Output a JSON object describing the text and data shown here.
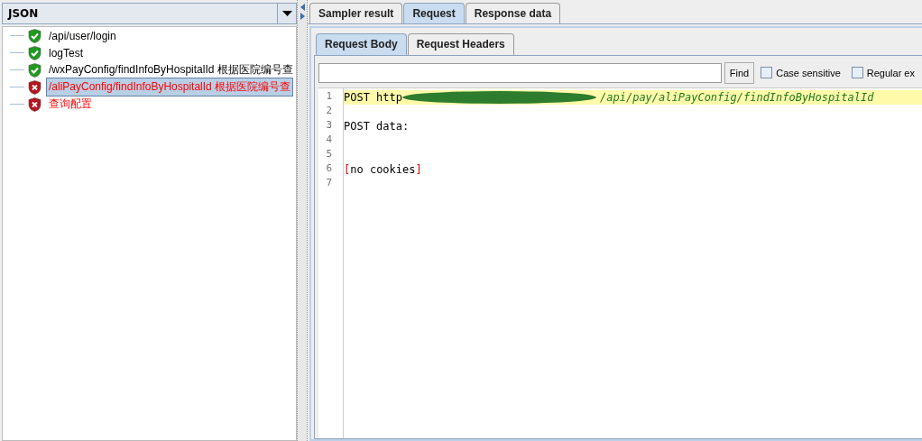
{
  "left_panel": {
    "combo": {
      "value": "JSON"
    },
    "tree": [
      {
        "label": "/api/user/login",
        "kind": "success",
        "selected": false
      },
      {
        "label": "logTest",
        "kind": "success",
        "selected": false
      },
      {
        "label": "/wxPayConfig/findInfoByHospitalId 根据医院编号查",
        "kind": "success",
        "selected": false
      },
      {
        "label": "/aliPayConfig/findInfoByHospitalId 根据医院编号查",
        "kind": "failure",
        "selected": true
      },
      {
        "label": "查询配置",
        "kind": "failure",
        "selected": false
      }
    ]
  },
  "tabs": [
    {
      "label": "Sampler result",
      "selected": false
    },
    {
      "label": "Request",
      "selected": true
    },
    {
      "label": "Response data",
      "selected": false
    }
  ],
  "sub_tabs": [
    {
      "label": "Request Body",
      "selected": true
    },
    {
      "label": "Request Headers",
      "selected": false
    }
  ],
  "search": {
    "button": "Find",
    "options": [
      {
        "label": "Case sensitive",
        "checked": false
      },
      {
        "label": "Regular ex",
        "checked": false
      }
    ]
  },
  "editor": {
    "lines": [
      {
        "number": "1",
        "highlighted": true,
        "segments": [
          {
            "kind": "plain",
            "text": "POST http"
          },
          {
            "kind": "redacted"
          },
          {
            "kind": "url",
            "text": "/api/pay/aliPayConfig/findInfoByHospitalId"
          }
        ]
      },
      {
        "number": "2",
        "highlighted": false
      },
      {
        "number": "3",
        "highlighted": false,
        "segments": [
          {
            "kind": "plain",
            "text": "POST data:"
          }
        ]
      },
      {
        "number": "4",
        "highlighted": false
      },
      {
        "number": "5",
        "highlighted": false
      },
      {
        "number": "6",
        "highlighted": false,
        "segments": [
          {
            "kind": "bracket",
            "text": "["
          },
          {
            "kind": "plain",
            "text": "no cookies"
          },
          {
            "kind": "bracket",
            "text": "]"
          }
        ]
      },
      {
        "number": "7",
        "highlighted": false
      }
    ]
  }
}
